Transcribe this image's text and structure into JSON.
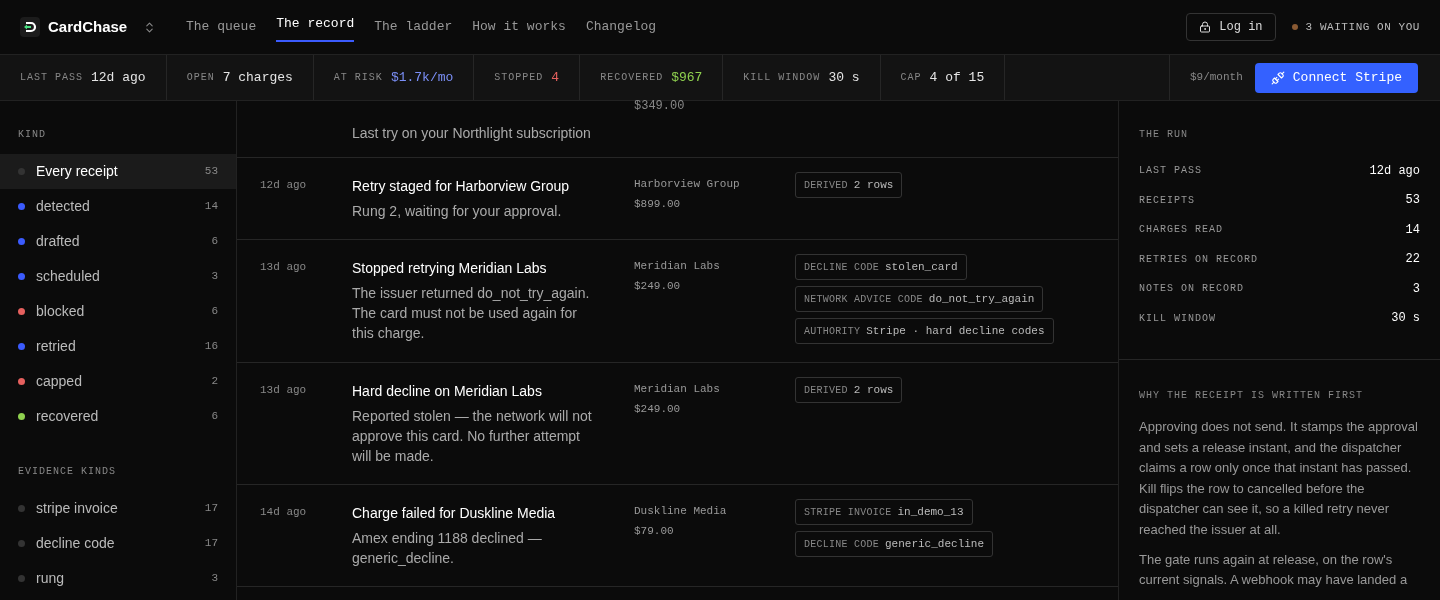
{
  "brand": {
    "name": "CardChase"
  },
  "nav": [
    {
      "label": "The queue",
      "selected": false
    },
    {
      "label": "The record",
      "selected": true
    },
    {
      "label": "The ladder",
      "selected": false
    },
    {
      "label": "How it works",
      "selected": false
    },
    {
      "label": "Changelog",
      "selected": false
    }
  ],
  "login": {
    "label": "Log in"
  },
  "waiting": {
    "label": "3 WAITING ON YOU",
    "color": "#8a5a33"
  },
  "stats": [
    {
      "label": "LAST PASS",
      "value": "12d ago",
      "color": "#e5e5e5"
    },
    {
      "label": "OPEN",
      "value": "7 charges",
      "color": "#e5e5e5"
    },
    {
      "label": "AT RISK",
      "value": "$1.7k/mo",
      "color": "#7b8ff7"
    },
    {
      "label": "STOPPED",
      "value": "4",
      "color": "#e5605e"
    },
    {
      "label": "RECOVERED",
      "value": "$967",
      "color": "#8fd14f"
    },
    {
      "label": "KILL WINDOW",
      "value": "30 s",
      "color": "#e5e5e5"
    },
    {
      "label": "CAP",
      "value": "4 of 15",
      "color": "#e5e5e5"
    }
  ],
  "price": "$9/month",
  "connect_button": {
    "label": "Connect Stripe"
  },
  "sidebar": [
    {
      "heading": "KIND",
      "items": [
        {
          "label": "Every receipt",
          "count": "53",
          "color": "#333333",
          "selected": true
        },
        {
          "label": "detected",
          "count": "14",
          "color": "#3b5bfd",
          "selected": false
        },
        {
          "label": "drafted",
          "count": "6",
          "color": "#3b5bfd",
          "selected": false
        },
        {
          "label": "scheduled",
          "count": "3",
          "color": "#3b5bfd",
          "selected": false
        },
        {
          "label": "blocked",
          "count": "6",
          "color": "#e5605e",
          "selected": false
        },
        {
          "label": "retried",
          "count": "16",
          "color": "#3b5bfd",
          "selected": false
        },
        {
          "label": "capped",
          "count": "2",
          "color": "#e5605e",
          "selected": false
        },
        {
          "label": "recovered",
          "count": "6",
          "color": "#8fd14f",
          "selected": false
        }
      ]
    },
    {
      "heading": "EVIDENCE KINDS",
      "items": [
        {
          "label": "stripe invoice",
          "count": "17",
          "color": "#333333",
          "selected": false
        },
        {
          "label": "decline code",
          "count": "17",
          "color": "#333333",
          "selected": false
        },
        {
          "label": "rung",
          "count": "3",
          "color": "#333333",
          "selected": false
        }
      ]
    }
  ],
  "records": [
    {
      "kind": "partial",
      "description": "Last try on your Northlight subscription",
      "amount": "$349.00"
    },
    {
      "kind": "full",
      "time": "12d ago",
      "title": "Retry staged for Harborview Group",
      "description": "Rung 2, waiting for your approval.",
      "client": "Harborview Group",
      "amount": "$899.00",
      "tags": [
        {
          "key": "DERIVED",
          "value": "2 rows"
        }
      ]
    },
    {
      "kind": "full",
      "time": "13d ago",
      "title": "Stopped retrying Meridian Labs",
      "description": "The issuer returned do_not_try_again. The card must not be used again for this charge.",
      "client": "Meridian Labs",
      "amount": "$249.00",
      "tags": [
        {
          "key": "DECLINE CODE",
          "value": "stolen_card"
        },
        {
          "key": "NETWORK ADVICE CODE",
          "value": "do_not_try_again"
        },
        {
          "key": "AUTHORITY",
          "value": "Stripe · hard decline codes"
        }
      ]
    },
    {
      "kind": "full",
      "time": "13d ago",
      "title": "Hard decline on Meridian Labs",
      "description": "Reported stolen — the network will not approve this card. No further attempt will be made.",
      "client": "Meridian Labs",
      "amount": "$249.00",
      "tags": [
        {
          "key": "DERIVED",
          "value": "2 rows"
        }
      ]
    },
    {
      "kind": "full",
      "time": "14d ago",
      "title": "Charge failed for Duskline Media",
      "description": "Amex ending 1188 declined — generic_decline.",
      "client": "Duskline Media",
      "amount": "$79.00",
      "tags": [
        {
          "key": "STRIPE INVOICE",
          "value": "in_demo_13"
        },
        {
          "key": "DECLINE CODE",
          "value": "generic_decline"
        }
      ]
    }
  ],
  "run": {
    "heading": "THE RUN",
    "rows": [
      {
        "label": "LAST PASS",
        "value": "12d ago"
      },
      {
        "label": "RECEIPTS",
        "value": "53"
      },
      {
        "label": "CHARGES READ",
        "value": "14"
      },
      {
        "label": "RETRIES ON RECORD",
        "value": "22"
      },
      {
        "label": "NOTES ON RECORD",
        "value": "3"
      },
      {
        "label": "KILL WINDOW",
        "value": "30 s"
      }
    ]
  },
  "why": {
    "heading": "WHY THE RECEIPT IS WRITTEN FIRST",
    "paragraphs": [
      "Approving does not send. It stamps the approval and sets a release instant, and the dispatcher claims a row only once that instant has passed. Kill flips the row to cancelled before the dispatcher can see it, so a killed retry never reached the issuer at all.",
      "The gate runs again at release, on the row's current signals. A webhook may have landed a"
    ]
  }
}
